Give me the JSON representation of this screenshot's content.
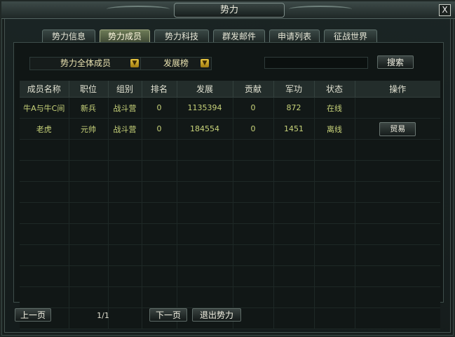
{
  "window": {
    "title": "势力",
    "close_label": "X"
  },
  "tabs": [
    {
      "label": "势力信息"
    },
    {
      "label": "势力成员"
    },
    {
      "label": "势力科技"
    },
    {
      "label": "群发邮件"
    },
    {
      "label": "申请列表"
    },
    {
      "label": "征战世界"
    }
  ],
  "filters": {
    "member_scope": "势力全体成员",
    "ranking": "发展榜",
    "search_value": "",
    "search_button": "搜索"
  },
  "table": {
    "columns": [
      "成员名称",
      "职位",
      "组别",
      "排名",
      "发展",
      "贡献",
      "军功",
      "状态",
      "操作"
    ],
    "rows": [
      {
        "name": "牛A与牛C间",
        "position": "新兵",
        "group": "战斗营",
        "rank": "0",
        "development": "1135394",
        "contribution": "0",
        "merit": "872",
        "status": "在线",
        "action": ""
      },
      {
        "name": "老虎",
        "position": "元帅",
        "group": "战斗营",
        "rank": "0",
        "development": "184554",
        "contribution": "0",
        "merit": "1451",
        "status": "离线",
        "action": "贸易"
      }
    ]
  },
  "footer": {
    "prev_page": "上一页",
    "page_indicator": "1/1",
    "next_page": "下一页",
    "leave_faction": "退出势力"
  }
}
